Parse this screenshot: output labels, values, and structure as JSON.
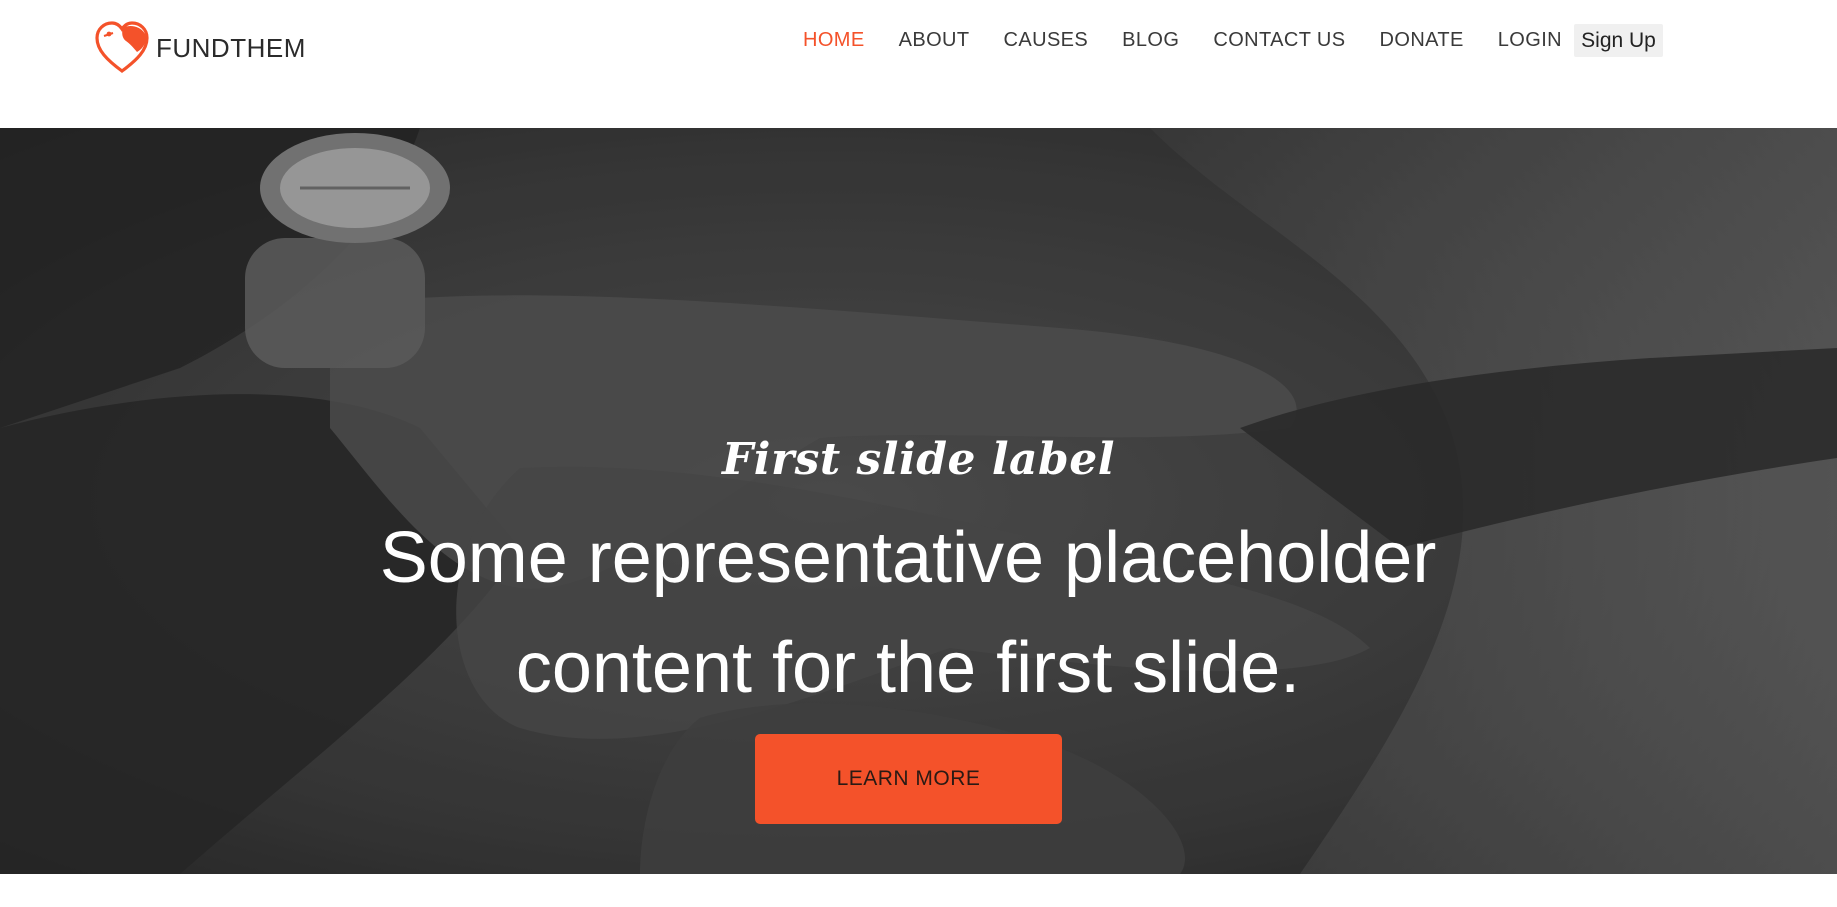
{
  "brand": {
    "name": "FUNDTHEM",
    "logo_icon": "heart-logo-icon",
    "accent_color": "#f4522a"
  },
  "nav": {
    "items": [
      {
        "label": "HOME",
        "active": true
      },
      {
        "label": "ABOUT",
        "active": false
      },
      {
        "label": "CAUSES",
        "active": false
      },
      {
        "label": "BLOG",
        "active": false
      },
      {
        "label": "CONTACT US",
        "active": false
      },
      {
        "label": "DONATE",
        "active": false
      },
      {
        "label": "LOGIN",
        "active": false
      }
    ],
    "signup_label": "Sign Up"
  },
  "hero": {
    "slide_label": "First slide label",
    "slide_text": "Some representative placeholder content for the first slide.",
    "button_label": "LEARN MORE"
  }
}
